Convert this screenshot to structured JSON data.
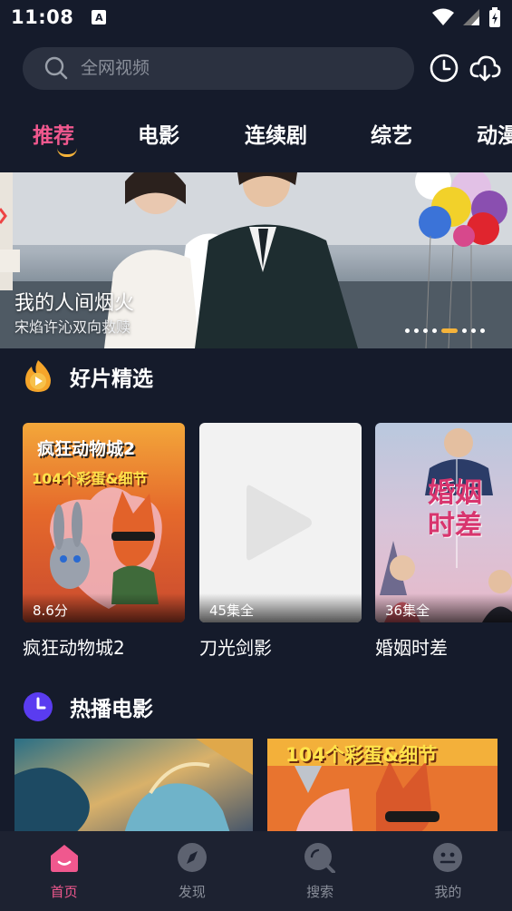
{
  "status": {
    "time": "11:08",
    "keyboard_badge": "A"
  },
  "search": {
    "placeholder": "全网视频"
  },
  "tabs": [
    {
      "label": "推荐",
      "active": true
    },
    {
      "label": "电影"
    },
    {
      "label": "连续剧"
    },
    {
      "label": "综艺"
    },
    {
      "label": "动漫"
    }
  ],
  "banner": {
    "title": "我的人间烟火",
    "subtitle": "宋焰许沁双向救赎",
    "slide_count": 8,
    "active_slide": 4
  },
  "featured": {
    "title": "好片精选",
    "items": [
      {
        "title": "疯狂动物城2",
        "badge": "8.6分",
        "poster_text_1": "疯狂动物城2",
        "poster_text_2": "104个彩蛋&细节"
      },
      {
        "title": "刀光剑影",
        "badge": "45集全"
      },
      {
        "title": "婚姻时差",
        "badge": "36集全",
        "poster_text": "婚姻时差"
      }
    ]
  },
  "hot_movies": {
    "title": "热播电影",
    "poster2_text": "104个彩蛋&细节"
  },
  "nav": [
    {
      "label": "首页",
      "active": true
    },
    {
      "label": "发现"
    },
    {
      "label": "搜索"
    },
    {
      "label": "我的"
    }
  ],
  "colors": {
    "accent": "#f0588e",
    "underline": "#f5b33a",
    "background": "#151b2b"
  }
}
